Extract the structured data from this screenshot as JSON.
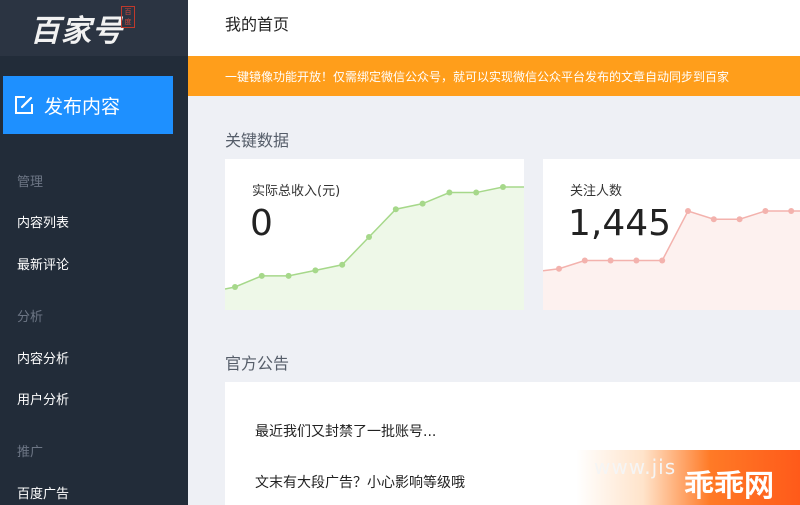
{
  "sidebar": {
    "logo_text": "百家号",
    "logo_seal": "百度",
    "publish_label": "发布内容",
    "groups": [
      {
        "label": "管理",
        "items": [
          "内容列表",
          "最新评论"
        ]
      },
      {
        "label": "分析",
        "items": [
          "内容分析",
          "用户分析"
        ]
      },
      {
        "label": "推广",
        "items": [
          "百度广告"
        ]
      }
    ]
  },
  "header": {
    "title": "我的首页"
  },
  "notice": {
    "text": "一键镜像功能开放！仅需绑定微信公众号，就可以实现微信公众平台发布的文章自动同步到百家"
  },
  "key_data": {
    "title": "关键数据",
    "cards": [
      {
        "label": "实际总收入(元)",
        "value": "0",
        "color": "#a6d88a",
        "fill": "#eef8e8",
        "chart_values": [
          0,
          2,
          2,
          3,
          4,
          9,
          14,
          15,
          17,
          17,
          18,
          18
        ]
      },
      {
        "label": "关注人数",
        "value": "1,445",
        "color": "#f3b2ad",
        "fill": "#fdf1ef",
        "chart_values": [
          1,
          2,
          2,
          2,
          2,
          8,
          7,
          7,
          8,
          8
        ]
      }
    ]
  },
  "announcements": {
    "title": "官方公告",
    "items": [
      "最近我们又封禁了一批账号...",
      "文末有大段广告？小心影响等级哦"
    ]
  },
  "watermark": {
    "url": "www.jis",
    "brand": "乖乖网"
  }
}
